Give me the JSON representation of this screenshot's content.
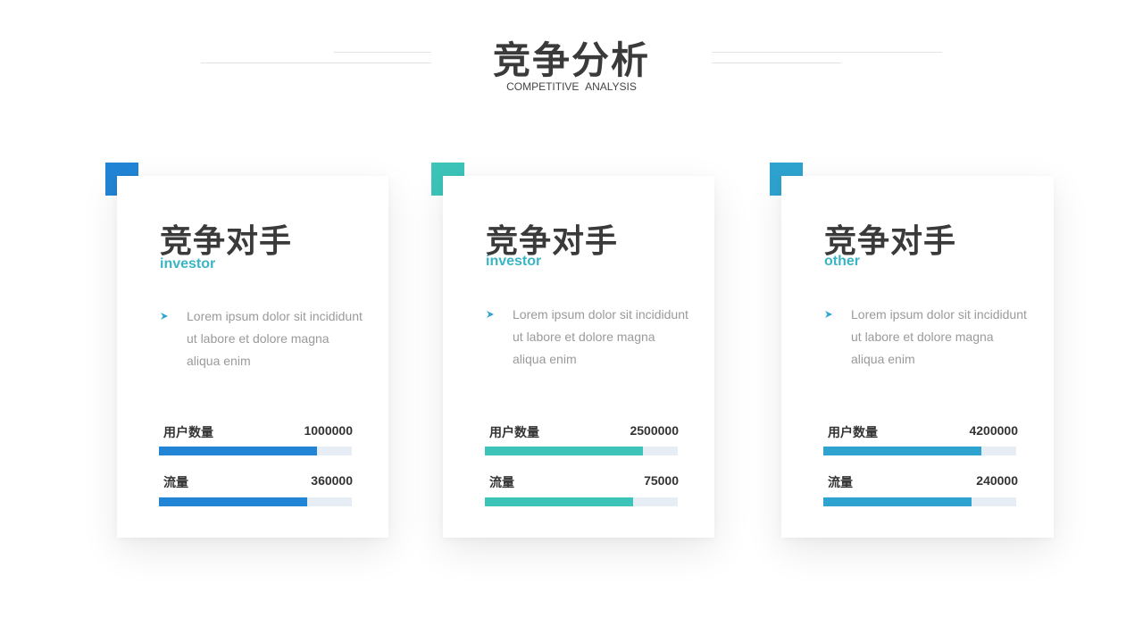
{
  "header": {
    "title": "竞争分析",
    "subtitle": "COMPETITIVE ANALYSIS"
  },
  "cards": [
    {
      "title": "竞争对手",
      "subtitle": "investor",
      "accent_color": "#2184d4",
      "bullet_icon": "arrow-bullet-icon",
      "description": "Lorem ipsum dolor sit incididunt ut labore et dolore magna aliqua enim",
      "metrics": [
        {
          "label": "用户数量",
          "value": "1000000",
          "fill": 0.82
        },
        {
          "label": "流量",
          "value": "360000",
          "fill": 0.77
        }
      ]
    },
    {
      "title": "竞争对手",
      "subtitle": "investor",
      "accent_color": "#3cc4b9",
      "bullet_icon": "arrow-bullet-icon",
      "description": "Lorem ipsum dolor sit incididunt ut labore et dolore magna aliqua enim",
      "metrics": [
        {
          "label": "用户数量",
          "value": "2500000",
          "fill": 0.82
        },
        {
          "label": "流量",
          "value": "75000",
          "fill": 0.77
        }
      ]
    },
    {
      "title": "竞争对手",
      "subtitle": "other",
      "accent_color": "#2ea3cf",
      "bullet_icon": "arrow-bullet-icon",
      "description": "Lorem ipsum dolor sit incididunt ut labore et dolore magna aliqua enim",
      "metrics": [
        {
          "label": "用户数量",
          "value": "4200000",
          "fill": 0.82
        },
        {
          "label": "流量",
          "value": "240000",
          "fill": 0.77
        }
      ]
    }
  ]
}
